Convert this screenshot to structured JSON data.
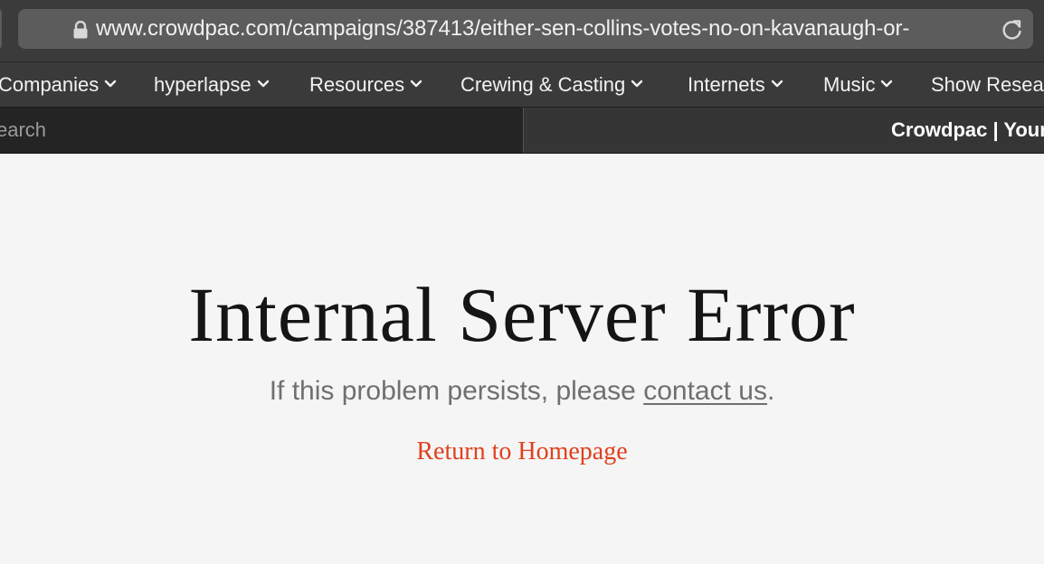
{
  "browser": {
    "url": "www.crowdpac.com/campaigns/387413/either-sen-collins-votes-no-on-kavanaugh-or-",
    "icons": {
      "lock": "lock-icon",
      "reload": "reload-icon"
    }
  },
  "bookmarks": [
    {
      "label": "Companies"
    },
    {
      "label": "hyperlapse"
    },
    {
      "label": "Resources"
    },
    {
      "label": "Crewing & Casting"
    },
    {
      "label": "Internets"
    },
    {
      "label": "Music"
    },
    {
      "label": "Show Resea"
    }
  ],
  "tabs": {
    "search_tab_text": "earch",
    "active_tab_title": "Crowdpac | Your"
  },
  "page": {
    "title": "Internal Server Error",
    "message_prefix": "If this problem persists, please ",
    "contact_link": "contact us",
    "message_suffix": ".",
    "home_link": "Return to Homepage"
  },
  "colors": {
    "accent_link": "#e0401d",
    "chrome_dark": "#3a3a3a",
    "page_background": "#f5f5f5"
  }
}
